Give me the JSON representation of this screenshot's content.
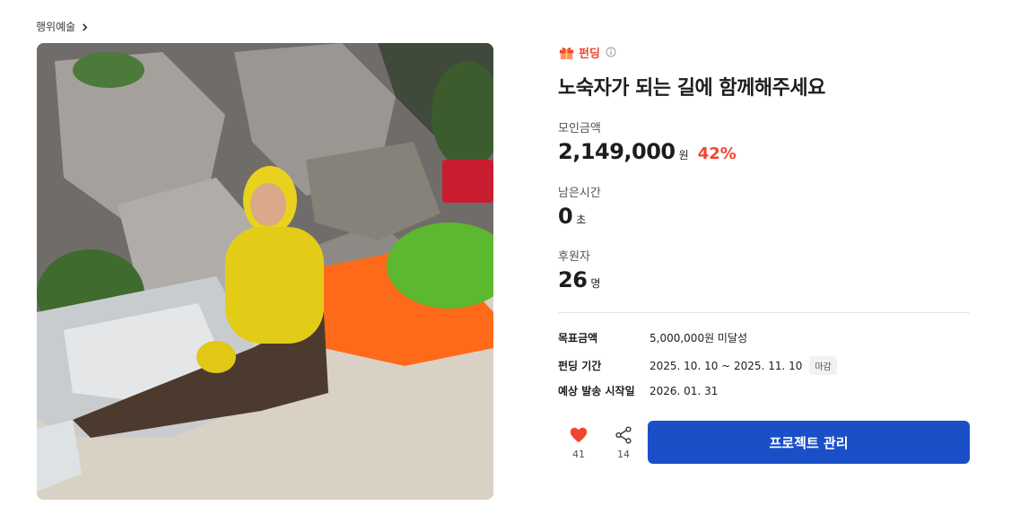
{
  "breadcrumb": {
    "label": "행위예술"
  },
  "project": {
    "status_label": "펀딩",
    "title": "노숙자가 되는 길에 함께해주세요"
  },
  "stats": {
    "raised": {
      "label": "모인금액",
      "value": "2,149,000",
      "unit": "원",
      "percent": "42%"
    },
    "time_left": {
      "label": "남은시간",
      "value": "0",
      "unit": "초"
    },
    "backers": {
      "label": "후원자",
      "value": "26",
      "unit": "명"
    }
  },
  "details": {
    "goal": {
      "key": "목표금액",
      "value": "5,000,000원 미달성"
    },
    "period": {
      "key": "펀딩 기간",
      "value": "2025. 10. 10 ~ 2025. 11. 10",
      "badge": "마감"
    },
    "ship": {
      "key": "예상 발송 시작일",
      "value": "2026. 01. 31"
    }
  },
  "actions": {
    "like_count": "41",
    "share_count": "14",
    "manage_label": "프로젝트 관리"
  },
  "colors": {
    "accent_red": "#f0462f",
    "primary_blue": "#1a4fc8",
    "heart": "#f0462f"
  },
  "icons": [
    "chevron-right-icon",
    "gift-icon",
    "info-icon",
    "heart-icon",
    "share-icon"
  ]
}
